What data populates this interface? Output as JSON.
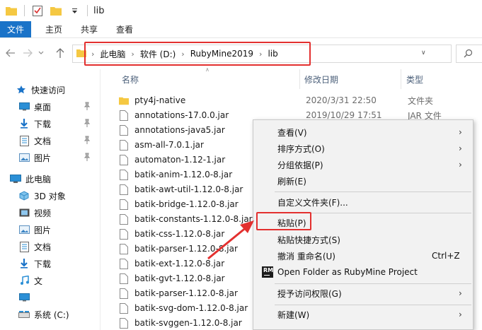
{
  "window": {
    "title": "lib"
  },
  "ribbon": {
    "tabs": [
      "文件",
      "主页",
      "共享",
      "查看"
    ]
  },
  "address": {
    "crumbs": [
      "此电脑",
      "软件 (D:)",
      "RubyMine2019",
      "lib"
    ]
  },
  "nav": {
    "items": [
      {
        "label": "快速访问",
        "icon": "star-icon"
      },
      {
        "label": "桌面",
        "icon": "desktop-icon"
      },
      {
        "label": "下载",
        "icon": "download-icon"
      },
      {
        "label": "文档",
        "icon": "document-icon"
      },
      {
        "label": "图片",
        "icon": "picture-icon"
      },
      {
        "label": "此电脑",
        "icon": "pc-icon"
      },
      {
        "label": "3D 对象",
        "icon": "cube-icon"
      },
      {
        "label": "视频",
        "icon": "video-icon"
      },
      {
        "label": "图片",
        "icon": "picture-icon"
      },
      {
        "label": "文档",
        "icon": "document-icon"
      },
      {
        "label": "下载",
        "icon": "download-icon"
      },
      {
        "label": "文",
        "icon": "music-icon"
      },
      {
        "label": "",
        "icon": "desktop-icon"
      },
      {
        "label": "系统 (C:)",
        "icon": "drive-icon"
      }
    ]
  },
  "columns": {
    "name": "名称",
    "date": "修改日期",
    "type": "类型"
  },
  "files": [
    {
      "name": "pty4j-native",
      "date": "2020/3/31 22:50",
      "type": "文件夹",
      "kind": "folder"
    },
    {
      "name": "annotations-17.0.0.jar",
      "date": "2019/10/29 17:51",
      "type": "JAR 文件",
      "kind": "file"
    },
    {
      "name": "annotations-java5.jar",
      "date": "",
      "type": "",
      "kind": "file"
    },
    {
      "name": "asm-all-7.0.1.jar",
      "date": "",
      "type": "",
      "kind": "file"
    },
    {
      "name": "automaton-1.12-1.jar",
      "date": "",
      "type": "",
      "kind": "file"
    },
    {
      "name": "batik-anim-1.12.0-8.jar",
      "date": "",
      "type": "",
      "kind": "file"
    },
    {
      "name": "batik-awt-util-1.12.0-8.jar",
      "date": "",
      "type": "",
      "kind": "file"
    },
    {
      "name": "batik-bridge-1.12.0-8.jar",
      "date": "",
      "type": "",
      "kind": "file"
    },
    {
      "name": "batik-constants-1.12.0-8.jar",
      "date": "",
      "type": "",
      "kind": "file"
    },
    {
      "name": "batik-css-1.12.0-8.jar",
      "date": "",
      "type": "",
      "kind": "file"
    },
    {
      "name": "batik-parser-1.12.0-8.jar",
      "date": "",
      "type": "",
      "kind": "file"
    },
    {
      "name": "batik-ext-1.12.0-8.jar",
      "date": "",
      "type": "",
      "kind": "file"
    },
    {
      "name": "batik-gvt-1.12.0-8.jar",
      "date": "",
      "type": "",
      "kind": "file"
    },
    {
      "name": "batik-parser-1.12.0-8.jar",
      "date": "",
      "type": "",
      "kind": "file"
    },
    {
      "name": "batik-svg-dom-1.12.0-8.jar",
      "date": "",
      "type": "",
      "kind": "file"
    },
    {
      "name": "batik-svggen-1.12.0-8.jar",
      "date": "",
      "type": "",
      "kind": "file"
    }
  ],
  "menu": {
    "view": "查看(V)",
    "sort": "排序方式(O)",
    "group": "分组依据(P)",
    "refresh": "刷新(E)",
    "customize": "自定义文件夹(F)...",
    "paste": "粘贴(P)",
    "paste_shortcut": "粘贴快捷方式(S)",
    "undo": "撤消 重命名(U)",
    "undo_key": "Ctrl+Z",
    "open_rubymine": "Open Folder as RubyMine Project",
    "rubymine_icon_text": "RM",
    "access": "授予访问权限(G)",
    "new": "新建(W)"
  },
  "colors": {
    "accent": "#1a73c8",
    "annotation": "#e3302f",
    "folder": "#f5c842"
  }
}
